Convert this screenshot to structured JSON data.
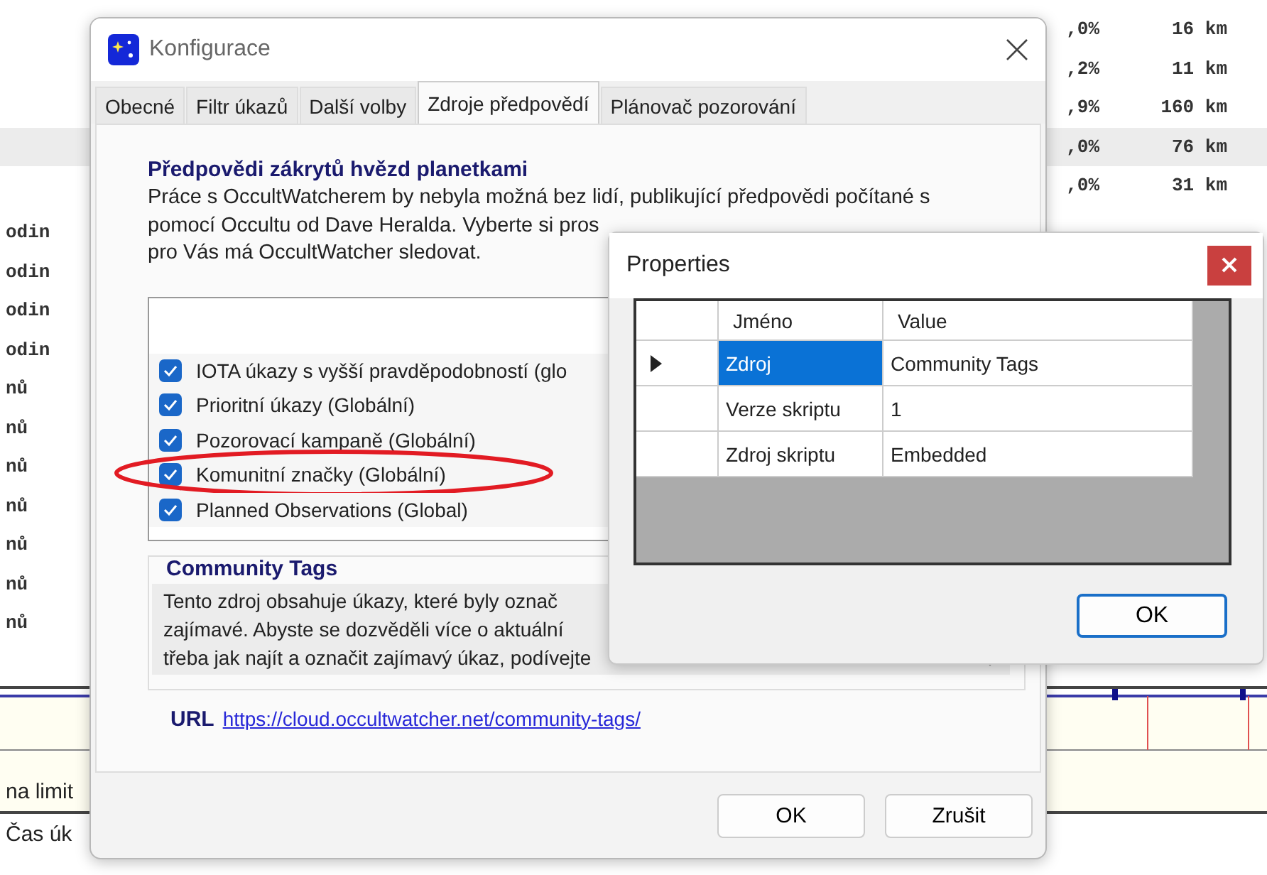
{
  "background_app": {
    "right_rows": [
      {
        "percent": ",0%",
        "distance": "16 km",
        "highlighted": false
      },
      {
        "percent": ",2%",
        "distance": "11 km",
        "highlighted": false
      },
      {
        "percent": ",9%",
        "distance": "160 km",
        "highlighted": false
      },
      {
        "percent": ",0%",
        "distance": "76 km",
        "highlighted": true
      },
      {
        "percent": ",0%",
        "distance": "31 km",
        "highlighted": false
      }
    ],
    "left_rows": [
      "odin",
      "odin",
      "odin",
      "odin",
      "nů",
      "nů",
      "nů",
      "nů",
      "nů",
      "nů",
      "nů"
    ],
    "labels": [
      "na limit",
      "Čas úk"
    ]
  },
  "config_dialog": {
    "title": "Konfigurace",
    "tabs": [
      {
        "label": "Obecné",
        "selected": false
      },
      {
        "label": "Filtr úkazů",
        "selected": false
      },
      {
        "label": "Další volby",
        "selected": false
      },
      {
        "label": "Zdroje předpovědí",
        "selected": true
      },
      {
        "label": "Plánovač pozorování",
        "selected": false
      }
    ],
    "heading": "Předpovědi zákrytů hvězd planetkami",
    "intro_lines": [
      "Práce s OccultWatcherem by nebyla možná bez lidí, publikující předpovědi počítané s",
      "pomocí Occultu od Dave Heralda. Vyberte si pros",
      "pro Vás má OccultWatcher sledovat."
    ],
    "sources": [
      {
        "label": "IOTA úkazy s vyšší pravděpodobností (glo",
        "checked": true,
        "circled": false
      },
      {
        "label": "Prioritní úkazy (Globální)",
        "checked": true,
        "circled": false
      },
      {
        "label": "Pozorovací kampaně (Globální)",
        "checked": true,
        "circled": false
      },
      {
        "label": "Komunitní značky (Globální)",
        "checked": true,
        "circled": true
      },
      {
        "label": "Planned Observations (Global)",
        "checked": true,
        "circled": false
      }
    ],
    "group_title": "Community Tags",
    "description_lines": [
      "Tento zdroj obsahuje úkazy, které byly označ",
      "zajímavé. Abyste se dozvěděli více o aktuální",
      "třeba jak najít a označit zajímavý úkaz, podívejte"
    ],
    "url_label": "URL",
    "url": "https://cloud.occultwatcher.net/community-tags/",
    "buttons": [
      "OK",
      "Zrušit"
    ]
  },
  "properties_dialog": {
    "title": "Properties",
    "columns": [
      "Jméno",
      "Value"
    ],
    "rows": [
      {
        "name": "Zdroj",
        "value": "Community Tags",
        "selected": true
      },
      {
        "name": "Verze skriptu",
        "value": "1",
        "selected": false
      },
      {
        "name": "Zdroj skriptu",
        "value": "Embedded",
        "selected": false
      }
    ],
    "button": "OK"
  }
}
